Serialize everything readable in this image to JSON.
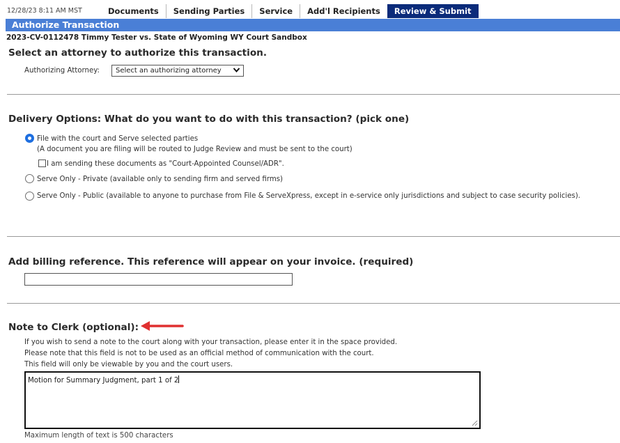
{
  "header": {
    "timestamp": "12/28/23 8:11 AM MST",
    "tabs": [
      {
        "label": "Documents"
      },
      {
        "label": "Sending Parties"
      },
      {
        "label": "Service"
      },
      {
        "label": "Add'l Recipients"
      },
      {
        "label": "Review & Submit",
        "active": true
      }
    ]
  },
  "title": "Authorize Transaction",
  "case_line": "2023-CV-0112478  Timmy Tester vs. State of Wyoming  WY Court Sandbox",
  "attorney": {
    "heading": "Select an attorney to authorize this transaction.",
    "label": "Authorizing Attorney:",
    "select_value": "Select an authorizing attorney"
  },
  "delivery": {
    "heading": "Delivery Options: What do you want to do with this transaction? (pick one)",
    "option1_label": "File with the court and Serve selected parties",
    "option1_note": "(A document you are filing will be routed to Judge Review and must be sent to the court)",
    "checkbox_label": "I am sending these documents as \"Court-Appointed Counsel/ADR\".",
    "option2_label": "Serve Only - Private (available only to sending firm and served firms)",
    "option3_label": "Serve Only - Public (available to anyone to purchase from File & ServeXpress, except in e-service only jurisdictions and subject to case security policies).",
    "selected": "option1"
  },
  "billing": {
    "heading": "Add billing reference. This reference will appear on your invoice. (required)",
    "value": ""
  },
  "note": {
    "heading": "Note to Clerk (optional):",
    "help_line1": "If you wish to send a note to the court along with your transaction, please enter it in the space provided.",
    "help_line2": "Please note that this field is not to be used as an official method of communication with the court.",
    "help_line3": "This field will only be viewable by you and the court users.",
    "value": "Motion for Summary Judgment, part 1 of 2",
    "max_length_text": "Maximum length of text is 500 characters"
  },
  "colors": {
    "title_bar": "#4a7fd6",
    "active_tab": "#0b2b7a",
    "radio_selected": "#1e6fe0",
    "annotation_arrow": "#e03030"
  }
}
